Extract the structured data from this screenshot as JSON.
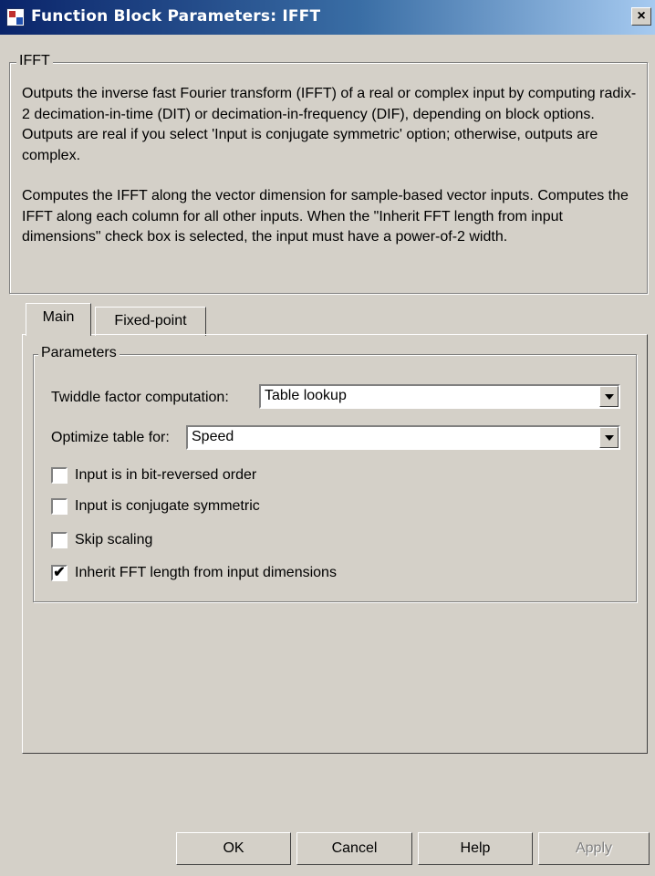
{
  "window": {
    "title": "Function Block Parameters: IFFT",
    "close_label": "×"
  },
  "block": {
    "name": "IFFT",
    "description_1": "Outputs the inverse fast Fourier transform (IFFT) of a real or complex input by computing radix-2 decimation-in-time (DIT) or decimation-in-frequency (DIF), depending on block options. Outputs are real if you select 'Input is conjugate symmetric' option; otherwise, outputs are complex.",
    "description_2": "Computes the IFFT along the vector dimension for sample-based vector inputs. Computes the IFFT along each column for all other inputs. When the \"Inherit FFT length from input dimensions\" check box is selected, the input must have a power-of-2 width."
  },
  "tabs": [
    {
      "label": "Main",
      "active": true
    },
    {
      "label": "Fixed-point",
      "active": false
    }
  ],
  "parameters": {
    "title": "Parameters",
    "twiddle_label": "Twiddle factor computation:",
    "twiddle_value": "Table lookup",
    "optimize_label": "Optimize table for:",
    "optimize_value": "Speed",
    "checkboxes": [
      {
        "label": "Input is in bit-reversed order",
        "checked": false
      },
      {
        "label": "Input is conjugate symmetric",
        "checked": false
      },
      {
        "label": "Skip scaling",
        "checked": false
      },
      {
        "label": "Inherit FFT length from input dimensions",
        "checked": true
      }
    ]
  },
  "buttons": {
    "ok": "OK",
    "cancel": "Cancel",
    "help": "Help",
    "apply": "Apply"
  },
  "colors": {
    "titlebar_start": "#0a246a",
    "titlebar_end": "#a6caf0",
    "dialog_bg": "#d4d0c8"
  }
}
